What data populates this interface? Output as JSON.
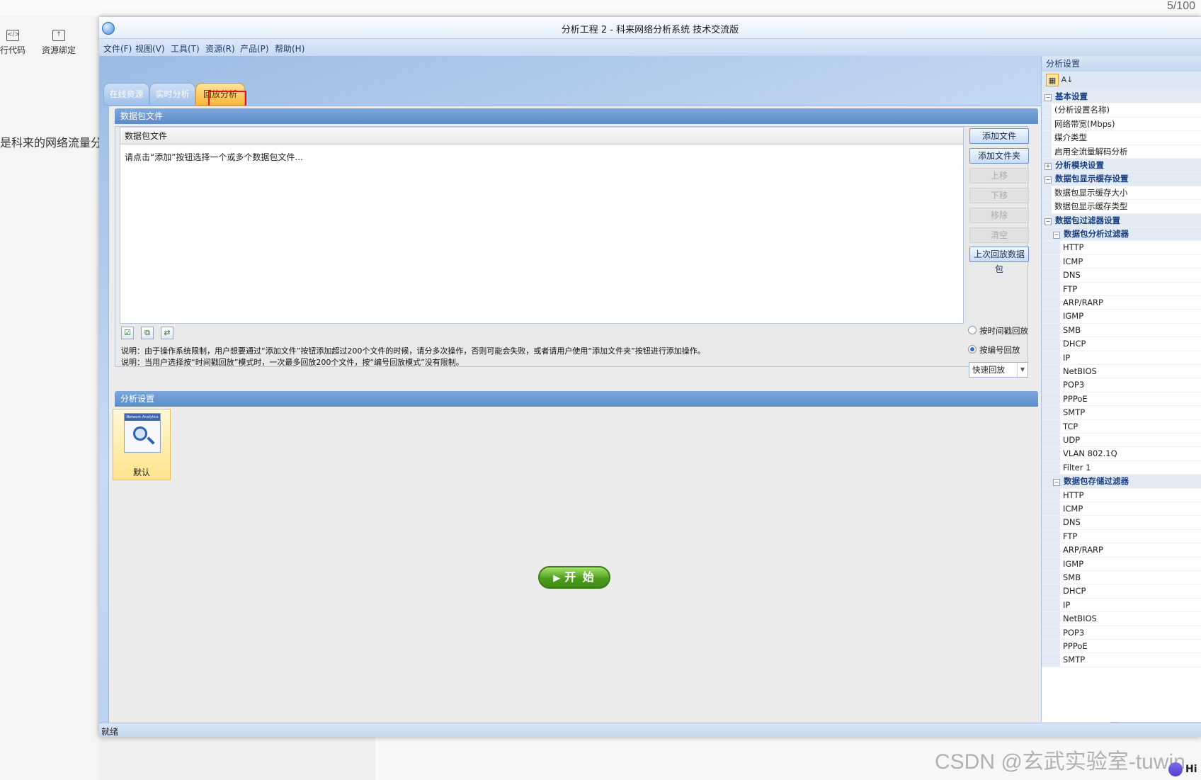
{
  "host": {
    "counter": "5/100",
    "tools": [
      "行代码",
      "资源绑定"
    ],
    "side_text": "是科来的网络流量分析",
    "watermark": "CSDN @玄武实验室-tuwin",
    "hi": "Hi"
  },
  "window": {
    "title": "分析工程 2 - 科来网络分析系统 技术交流版",
    "menu": [
      "文件(F)",
      "视图(V)",
      "工具(T)",
      "资源(R)",
      "产品(P)",
      "帮助(H)"
    ],
    "tabs": [
      "在线资源",
      "实时分析",
      "回放分析"
    ],
    "active_tab": "回放分析",
    "status": "就绪"
  },
  "files_section": {
    "header": "数据包文件",
    "list_header": "数据包文件",
    "hint": "请点击“添加”按钮选择一个或多个数据包文件...",
    "buttons": {
      "add_file": "添加文件",
      "add_folder": "添加文件夹",
      "move_up": "上移",
      "move_down": "下移",
      "remove": "移除",
      "clear": "清空",
      "last_replay": "上次回放数据包"
    },
    "notes": [
      "说明：由于操作系统限制，用户想要通过“添加文件”按钮添加超过200个文件的时候，请分多次操作，否则可能会失败，或者请用户使用“添加文件夹”按钮进行添加操作。",
      "说明：当用户选择按“时间戳回放”模式时，一次最多回放200个文件，按“编号回放模式”没有限制。"
    ],
    "replay_modes": [
      "按时间戳回放",
      "按编号回放"
    ],
    "selected_mode": "按编号回放",
    "speed": "快速回放"
  },
  "analysis_section": {
    "header": "分析设置",
    "tile_caption": "Network Analytics",
    "tile_label": "默认",
    "start": "开 始"
  },
  "props": {
    "title": "分析设置",
    "rows": [
      {
        "type": "cat",
        "level": 0,
        "label": "基本设置"
      },
      {
        "type": "item",
        "level": 0,
        "label": "(分析设置名称)"
      },
      {
        "type": "item",
        "level": 0,
        "label": "网络带宽(Mbps)"
      },
      {
        "type": "item",
        "level": 0,
        "label": "媒介类型"
      },
      {
        "type": "item",
        "level": 0,
        "label": "启用全流量解码分析"
      },
      {
        "type": "sub",
        "level": 0,
        "label": "分析模块设置"
      },
      {
        "type": "cat",
        "level": 0,
        "label": "数据包显示缓存设置"
      },
      {
        "type": "item",
        "level": 0,
        "label": "数据包显示缓存大小"
      },
      {
        "type": "item",
        "level": 0,
        "label": "数据包显示缓存类型"
      },
      {
        "type": "cat",
        "level": 0,
        "label": "数据包过滤器设置"
      },
      {
        "type": "cat",
        "level": 1,
        "label": "数据包分析过滤器"
      },
      {
        "type": "item",
        "level": 1,
        "label": "HTTP"
      },
      {
        "type": "item",
        "level": 1,
        "label": "ICMP"
      },
      {
        "type": "item",
        "level": 1,
        "label": "DNS"
      },
      {
        "type": "item",
        "level": 1,
        "label": "FTP"
      },
      {
        "type": "item",
        "level": 1,
        "label": "ARP/RARP"
      },
      {
        "type": "item",
        "level": 1,
        "label": "IGMP"
      },
      {
        "type": "item",
        "level": 1,
        "label": "SMB"
      },
      {
        "type": "item",
        "level": 1,
        "label": "DHCP"
      },
      {
        "type": "item",
        "level": 1,
        "label": "IP"
      },
      {
        "type": "item",
        "level": 1,
        "label": "NetBIOS"
      },
      {
        "type": "item",
        "level": 1,
        "label": "POP3"
      },
      {
        "type": "item",
        "level": 1,
        "label": "PPPoE"
      },
      {
        "type": "item",
        "level": 1,
        "label": "SMTP"
      },
      {
        "type": "item",
        "level": 1,
        "label": "TCP"
      },
      {
        "type": "item",
        "level": 1,
        "label": "UDP"
      },
      {
        "type": "item",
        "level": 1,
        "label": "VLAN 802.1Q"
      },
      {
        "type": "item",
        "level": 1,
        "label": "Filter 1"
      },
      {
        "type": "cat",
        "level": 1,
        "label": "数据包存储过滤器"
      },
      {
        "type": "item",
        "level": 1,
        "label": "HTTP"
      },
      {
        "type": "item",
        "level": 1,
        "label": "ICMP"
      },
      {
        "type": "item",
        "level": 1,
        "label": "DNS"
      },
      {
        "type": "item",
        "level": 1,
        "label": "FTP"
      },
      {
        "type": "item",
        "level": 1,
        "label": "ARP/RARP"
      },
      {
        "type": "item",
        "level": 1,
        "label": "IGMP"
      },
      {
        "type": "item",
        "level": 1,
        "label": "SMB"
      },
      {
        "type": "item",
        "level": 1,
        "label": "DHCP"
      },
      {
        "type": "item",
        "level": 1,
        "label": "IP"
      },
      {
        "type": "item",
        "level": 1,
        "label": "NetBIOS"
      },
      {
        "type": "item",
        "level": 1,
        "label": "POP3"
      },
      {
        "type": "item",
        "level": 1,
        "label": "PPPoE"
      },
      {
        "type": "item",
        "level": 1,
        "label": "SMTP"
      }
    ]
  }
}
